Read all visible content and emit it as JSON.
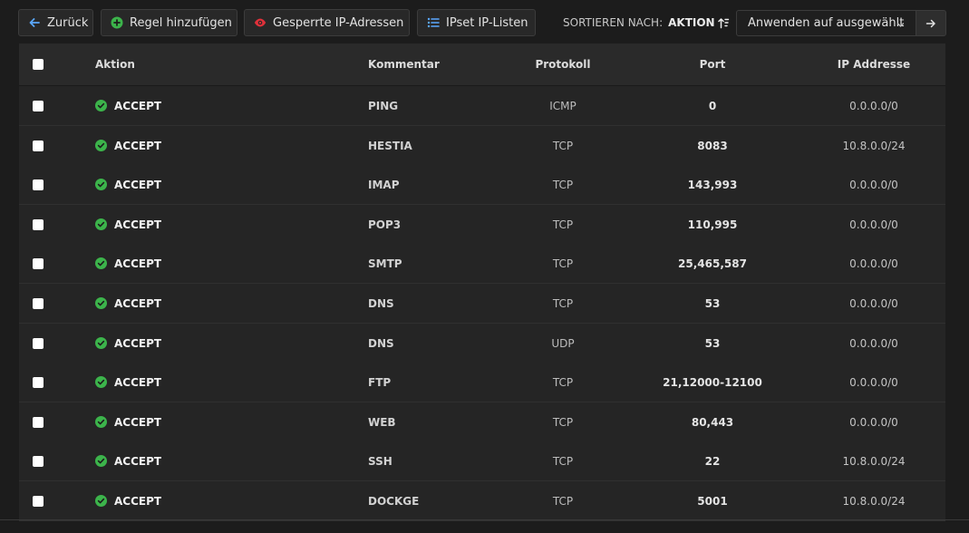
{
  "toolbar": {
    "back_label": "Zurück",
    "add_label": "Regel hinzufügen",
    "blocked_label": "Gesperrte IP-Adressen",
    "ipset_label": "IPset IP-Listen",
    "sort_label": "SORTIEREN NACH:",
    "sort_value": "AKTION",
    "bulk_select_value": "Anwenden auf ausgewählt"
  },
  "table": {
    "headers": {
      "action": "Aktion",
      "comment": "Kommentar",
      "protocol": "Protokoll",
      "port": "Port",
      "ip": "IP Addresse"
    },
    "rows": [
      {
        "action": "ACCEPT",
        "comment": "PING",
        "protocol": "ICMP",
        "port": "0",
        "ip": "0.0.0.0/0"
      },
      {
        "action": "ACCEPT",
        "comment": "HESTIA",
        "protocol": "TCP",
        "port": "8083",
        "ip": "10.8.0.0/24"
      },
      {
        "action": "ACCEPT",
        "comment": "IMAP",
        "protocol": "TCP",
        "port": "143,993",
        "ip": "0.0.0.0/0"
      },
      {
        "action": "ACCEPT",
        "comment": "POP3",
        "protocol": "TCP",
        "port": "110,995",
        "ip": "0.0.0.0/0"
      },
      {
        "action": "ACCEPT",
        "comment": "SMTP",
        "protocol": "TCP",
        "port": "25,465,587",
        "ip": "0.0.0.0/0"
      },
      {
        "action": "ACCEPT",
        "comment": "DNS",
        "protocol": "TCP",
        "port": "53",
        "ip": "0.0.0.0/0"
      },
      {
        "action": "ACCEPT",
        "comment": "DNS",
        "protocol": "UDP",
        "port": "53",
        "ip": "0.0.0.0/0"
      },
      {
        "action": "ACCEPT",
        "comment": "FTP",
        "protocol": "TCP",
        "port": "21,12000-12100",
        "ip": "0.0.0.0/0"
      },
      {
        "action": "ACCEPT",
        "comment": "WEB",
        "protocol": "TCP",
        "port": "80,443",
        "ip": "0.0.0.0/0"
      },
      {
        "action": "ACCEPT",
        "comment": "SSH",
        "protocol": "TCP",
        "port": "22",
        "ip": "10.8.0.0/24"
      },
      {
        "action": "ACCEPT",
        "comment": "DOCKGE",
        "protocol": "TCP",
        "port": "5001",
        "ip": "10.8.0.0/24"
      }
    ]
  },
  "icons": {
    "back": "arrow-left-icon",
    "add": "plus-circle-icon",
    "blocked": "eye-icon",
    "ipset": "list-icon",
    "sort": "sort-arrows-icon",
    "select": "chevron-down-icon",
    "apply": "arrow-right-icon",
    "accept": "check-circle-icon"
  },
  "colors": {
    "background": "#1c1c1c",
    "table_header": "#2a2a2a",
    "row": "#252525",
    "accept_green": "#3cb44b",
    "blocked_red": "#e0303a",
    "link_blue": "#5aa7ff"
  }
}
